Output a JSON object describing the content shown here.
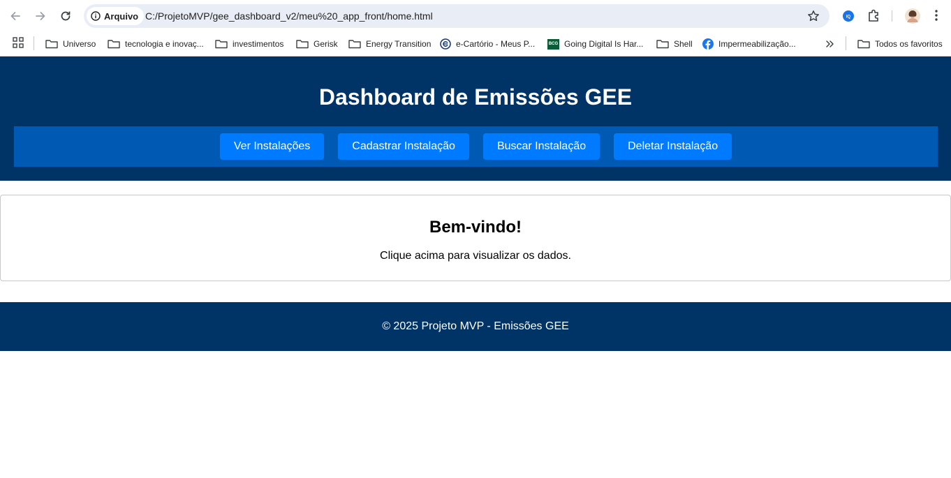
{
  "browser": {
    "address_chip": "Arquivo",
    "url": "C:/ProjetoMVP/gee_dashboard_v2/meu%20_app_front/home.html",
    "icons": [
      "back-arrow-icon",
      "forward-arrow-icon",
      "reload-icon",
      "info-icon",
      "star-icon",
      "extension-iq-icon",
      "puzzle-icon",
      "avatar",
      "kebab-menu-icon"
    ],
    "bookmarks": [
      {
        "label": "Universo",
        "icon": "folder-icon"
      },
      {
        "label": "tecnologia e inovaç...",
        "icon": "folder-icon"
      },
      {
        "label": "investimentos",
        "icon": "folder-icon"
      },
      {
        "label": "Gerisk",
        "icon": "folder-icon"
      },
      {
        "label": "Energy Transition",
        "icon": "folder-icon"
      },
      {
        "label": "e-Cartório - Meus P...",
        "icon": "ecartorio-icon"
      },
      {
        "label": "Going Digital Is Har...",
        "icon": "bcg-icon"
      },
      {
        "label": "Shell",
        "icon": "folder-icon"
      },
      {
        "label": "Impermeabilização...",
        "icon": "facebook-icon"
      }
    ],
    "all_bookmarks": "Todos os favoritos",
    "bcg_badge": "BCG"
  },
  "page": {
    "title": "Dashboard de Emissões GEE",
    "menu": [
      "Ver Instalações",
      "Cadastrar Instalação",
      "Buscar Instalação",
      "Deletar Instalação"
    ],
    "welcome_title": "Bem-vindo!",
    "welcome_text": "Clique acima para visualizar os dados.",
    "footer": "© 2025 Projeto MVP - Emissões GEE"
  },
  "colors": {
    "header_bg": "#003366",
    "menu_bg": "#0059b3",
    "button_bg": "#007bff"
  }
}
